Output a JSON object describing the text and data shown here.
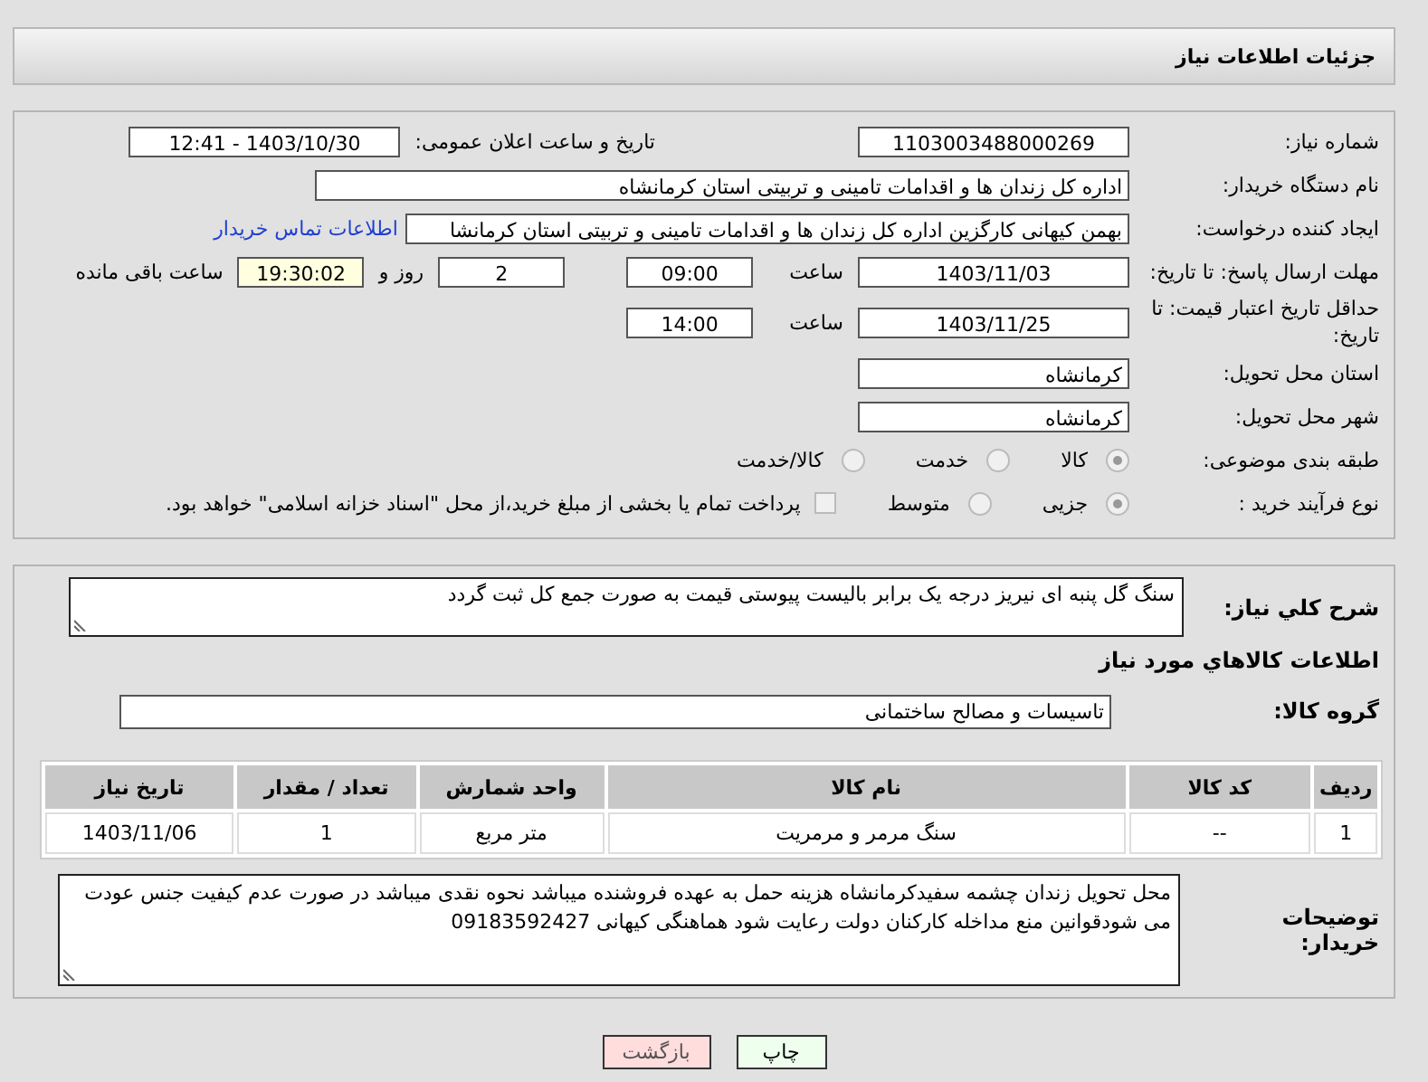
{
  "header": {
    "title": "جزئیات اطلاعات نیاز"
  },
  "need_number": {
    "label": "شماره نیاز:",
    "value": "1103003488000269"
  },
  "announce_datetime": {
    "label": "تاریخ و ساعت اعلان عمومی:",
    "value": "1403/10/30 - 12:41"
  },
  "buyer_org": {
    "label": "نام دستگاه خریدار:",
    "value": "اداره کل زندان ها و اقدامات تامینی و تربیتی استان کرمانشاه"
  },
  "requester": {
    "label": "ایجاد کننده درخواست:",
    "value": "بهمن کیهانی کارگزین اداره کل زندان ها و اقدامات تامینی و تربیتی استان کرمانشا",
    "link": "اطلاعات تماس خریدار"
  },
  "reply_deadline": {
    "label": "مهلت ارسال پاسخ: تا تاریخ:",
    "date": "1403/11/03",
    "time_label": "ساعت",
    "time": "09:00",
    "days": "2",
    "days_label": "روز و",
    "remaining": "19:30:02",
    "remaining_label": "ساعت باقی مانده"
  },
  "price_validity": {
    "label": "حداقل تاریخ اعتبار قیمت: تا تاریخ:",
    "date": "1403/11/25",
    "time_label": "ساعت",
    "time": "14:00"
  },
  "delivery_province": {
    "label": "استان محل تحویل:",
    "value": "کرمانشاه"
  },
  "delivery_city": {
    "label": "شهر محل تحویل:",
    "value": "کرمانشاه"
  },
  "category": {
    "label": "طبقه بندی موضوعی:",
    "options": [
      {
        "label": "کالا",
        "selected": true
      },
      {
        "label": "خدمت",
        "selected": false
      },
      {
        "label": "کالا/خدمت",
        "selected": false
      }
    ]
  },
  "purchase_type": {
    "label": "نوع فرآیند خرید :",
    "options": [
      {
        "label": "جزیی",
        "selected": true
      },
      {
        "label": "متوسط",
        "selected": false
      }
    ],
    "treasury": {
      "checked": false,
      "text": "پرداخت تمام یا بخشی از مبلغ خرید،از محل \"اسناد خزانه اسلامی\" خواهد بود."
    }
  },
  "summary": {
    "label": "شرح كلي نياز:",
    "value": "سنگ گل پنبه ای نیریز درجه یک برابر بالیست پیوستی قیمت به صورت جمع کل ثبت گردد"
  },
  "goods_heading": "اطلاعات كالاهاي مورد نياز",
  "goods_group": {
    "label": "گروه کالا:",
    "value": "تاسیسات و مصالح ساختمانی"
  },
  "table": {
    "columns": [
      "ردیف",
      "کد کالا",
      "نام کالا",
      "واحد شمارش",
      "تعداد / مقدار",
      "تاریخ نیاز"
    ],
    "rows": [
      [
        "1",
        "--",
        "سنگ مرمر و مرمریت",
        "متر مربع",
        "1",
        "1403/11/06"
      ]
    ]
  },
  "buyer_notes": {
    "label": "توضیحات خریدار:",
    "value": "محل تحویل زندان چشمه سفیدکرمانشاه هزینه حمل به عهده فروشنده میباشد نحوه نقدی میباشد در صورت عدم کیفیت جنس عودت می شودقوانین منع مداخله کارکنان دولت رعایت شود هماهنگی کیهانی  09183592427"
  },
  "buttons": [
    {
      "label": "چاپ",
      "kind": "print"
    },
    {
      "label": "بازگشت",
      "kind": "back"
    }
  ]
}
